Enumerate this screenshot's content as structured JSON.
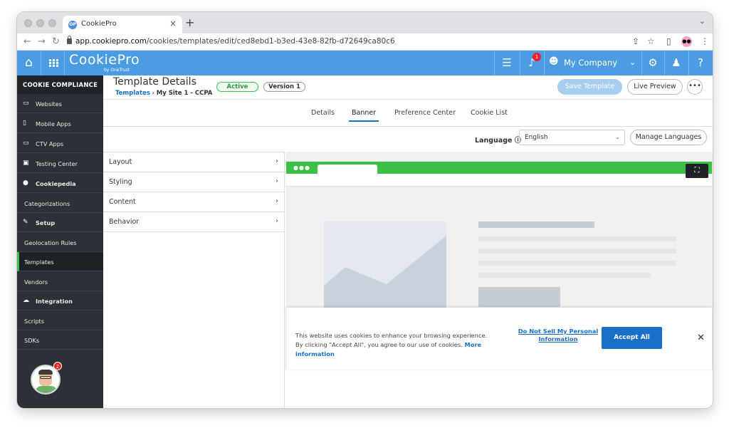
{
  "browser": {
    "tab_title": "CookiePro",
    "tab_favicon": "OP",
    "tab_close": "×",
    "new_tab": "+",
    "url_host": "app.cookiepro.com",
    "url_path": "/cookies/templates/edit/ced8ebd1-b3ed-43e8-82fb-d72649ca80c6"
  },
  "appbar": {
    "logo": "CookiePro",
    "logo_sub": "by OneTrust",
    "notification_count": "1",
    "company": "My Company"
  },
  "sidebar": {
    "header": "COOKIE COMPLIANCE",
    "items": [
      {
        "label": "Websites",
        "icon": "browser-icon",
        "glyph": "▭"
      },
      {
        "label": "Mobile Apps",
        "icon": "mobile-icon",
        "glyph": "▯"
      },
      {
        "label": "CTV Apps",
        "icon": "tv-icon",
        "glyph": "▭"
      },
      {
        "label": "Testing Center",
        "icon": "chart-icon",
        "glyph": "▣"
      },
      {
        "label": "Cookiepedia",
        "icon": "cookie-icon",
        "glyph": "●"
      },
      {
        "label": "Categorizations"
      },
      {
        "label": "Setup",
        "icon": "wrench-icon",
        "glyph": "✎"
      },
      {
        "label": "Geolocation Rules"
      },
      {
        "label": "Templates"
      },
      {
        "label": "Vendors"
      },
      {
        "label": "Integration",
        "icon": "cloud-icon",
        "glyph": "☁"
      },
      {
        "label": "Scripts"
      },
      {
        "label": "SDKs"
      }
    ],
    "avatar_badge": "2"
  },
  "header": {
    "title": "Template Details",
    "breadcrumb_link": "Templates",
    "breadcrumb_sep": "›",
    "breadcrumb_current": "My Site 1 - CCPA",
    "status": "Active",
    "version": "Version 1",
    "save_label": "Save Template",
    "preview_label": "Live Preview",
    "more_label": "•••"
  },
  "tabs": [
    "Details",
    "Banner",
    "Preference Center",
    "Cookie List"
  ],
  "language": {
    "label": "Language",
    "value": "English",
    "manage_label": "Manage Languages"
  },
  "accordion": [
    "Layout",
    "Styling",
    "Content",
    "Behavior"
  ],
  "banner": {
    "text": "This website uses cookies to enhance your browsing experience. By clicking \"Accept All\", you agree to our use of cookies.",
    "more_info": "More information",
    "dns_link": "Do Not Sell My Personal Information",
    "accept_label": "Accept All",
    "close": "✕"
  }
}
